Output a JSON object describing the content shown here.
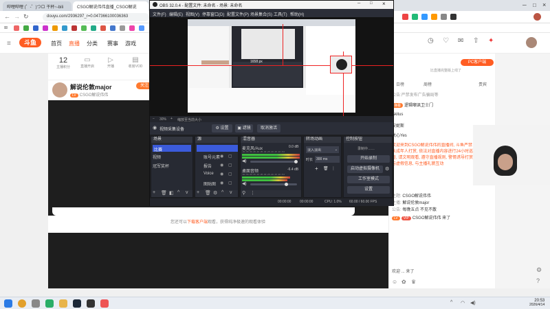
{
  "browser": {
    "tabs": [
      {
        "label": "哔哩哔哩 (゜-゜)つロ 干杯~-bili"
      },
      {
        "label": "CSGO解说伟伟直播_CSGO解说"
      }
    ],
    "url": "douyu.com/2936297_r=0.047366100036363"
  },
  "obs": {
    "title": "OBS 32.0.4 - 配置文件: 未命名 - 场景: 未命名",
    "menu": [
      "文件(F)",
      "编辑(E)",
      "视图(V)",
      "停靠窗口(D)",
      "配置文件(P)",
      "场景集合(S)",
      "工具(T)",
      "帮助(H)"
    ],
    "preview_label": "1658 px",
    "zoom_label": "30%",
    "zoom_hint": "缩放至当前大小",
    "source_name": "视频采集设备",
    "toolbar": {
      "settings": "设置",
      "filters": "滤镜",
      "deactivate": "取消激活"
    },
    "scenes": {
      "title": "场景",
      "items": [
        "比赛",
        "视频",
        "冠军奖杯"
      ]
    },
    "sources": {
      "title": "源",
      "items": [
        "账号元素",
        "报告",
        "Voice",
        "图贴图",
        "转换"
      ]
    },
    "mixer": {
      "title": "混音器",
      "tracks": [
        {
          "name": "麦克风/Aux",
          "db": "0.0 dB"
        },
        {
          "name": "桌面音频",
          "db": "-6.4 dB"
        }
      ],
      "scale": "-60 -55 -50 -45 -40 -35 -30 -25 -20 -15 -10 -5 0"
    },
    "transitions": {
      "title": "转场动画",
      "type": "淡入淡出",
      "duration_label": "时长",
      "duration": "300 ms"
    },
    "controls": {
      "title": "控制按钮",
      "status": "录制中……",
      "start_recording": "开始录制",
      "virtual_cam": "启动虚拟摄像机",
      "studio_mode": "工作室模式",
      "settings": "设置"
    },
    "status": {
      "time1": "00:00:00",
      "time2": "00:00:00",
      "cpu": "CPU: 1.0%",
      "fps": "60.00 / 60.00 FPS"
    }
  },
  "douyu": {
    "logo": "斗鱼",
    "nav": [
      "首页",
      "直播",
      "分类",
      "赛事",
      "游戏"
    ],
    "stats": [
      {
        "value": "12",
        "label": "主播积分"
      },
      {
        "value": "",
        "label": "直播开启"
      },
      {
        "value": "",
        "label": "开播"
      },
      {
        "value": "",
        "label": "收官VOD"
      }
    ],
    "streamer_name": "解说伦敦major",
    "streamer_follow": "关注",
    "streamer_sub": "CSGO解说伟伟",
    "below_player_text": "您还可以",
    "below_player_link": "下载客户端",
    "below_player_rest": "观看，获得纯净极速的观看体验",
    "pc_client": "PC客户端",
    "pc_client_sub": "比直播完整版上线了",
    "right_tabs": [
      "日榜",
      "周榜",
      "贵宾"
    ],
    "chat_lines": [
      {
        "badge": "",
        "user": "",
        "text": "公告:严禁发布广告骗局等"
      },
      {
        "badge": "弹幕",
        "user": "逻辑嘲讽卫士门",
        "text": ""
      },
      {
        "badge": "",
        "user": "Akitus",
        "text": ""
      },
      {
        "badge": "",
        "user": "安妮斯",
        "text": ""
      },
      {
        "badge": "",
        "user": "关心Yes",
        "text": ""
      }
    ],
    "announcement": "欢迎来到CSGO解说伟伟的直播间, 斗鱼严禁未成年人打赏, 依法对直播内容进行24小时巡查, 请文明观看, 遵守直播规则, 警惕诱导打赏与虚假信息, 与主播礼貌互动",
    "room_lines": [
      {
        "label": "主题:",
        "text": "CSGO解说伟伟"
      },
      {
        "label": "主播:",
        "text": "解说伦敦major"
      },
      {
        "label": "公告:",
        "text": "每晚五点 不见不散"
      }
    ],
    "welcome": "CSGO解说伟伟 来了",
    "bottom_chat": "欢迎 ... 来了"
  },
  "taskbar": {
    "time": "20:53",
    "date": "2026/4/14"
  }
}
